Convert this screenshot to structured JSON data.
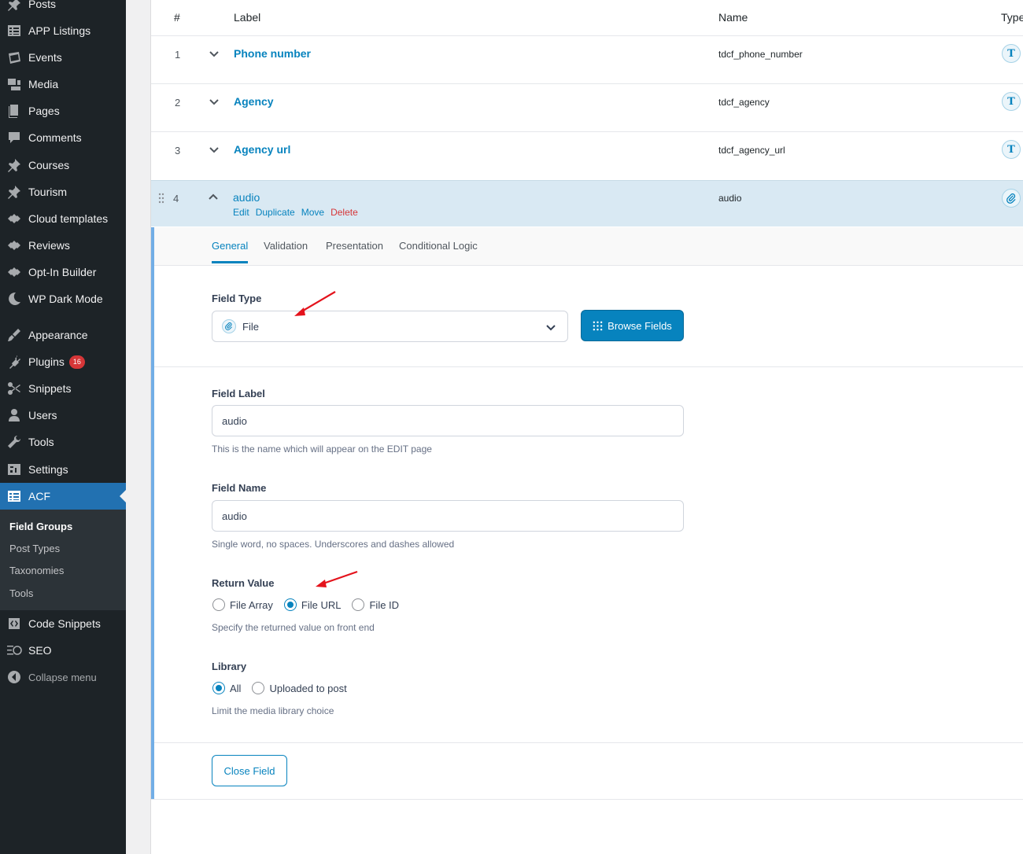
{
  "sidebar": {
    "items": [
      {
        "label": "Posts",
        "icon": "pin-icon"
      },
      {
        "label": "APP Listings",
        "icon": "table-icon"
      },
      {
        "label": "Events",
        "icon": "calendar-icon"
      },
      {
        "label": "Media",
        "icon": "media-icon"
      },
      {
        "label": "Pages",
        "icon": "page-icon"
      },
      {
        "label": "Comments",
        "icon": "comment-icon"
      },
      {
        "label": "Courses",
        "icon": "pin-icon"
      },
      {
        "label": "Tourism",
        "icon": "pin-icon"
      },
      {
        "label": "Cloud templates",
        "icon": "diamond-icon"
      },
      {
        "label": "Reviews",
        "icon": "diamond-icon"
      },
      {
        "label": "Opt-In Builder",
        "icon": "diamond-icon"
      },
      {
        "label": "WP Dark Mode",
        "icon": "moon-icon"
      },
      {
        "label": "Appearance",
        "icon": "brush-icon"
      },
      {
        "label": "Plugins",
        "icon": "plugin-icon",
        "badge": "16"
      },
      {
        "label": "Snippets",
        "icon": "scissors-icon"
      },
      {
        "label": "Users",
        "icon": "user-icon"
      },
      {
        "label": "Tools",
        "icon": "wrench-icon"
      },
      {
        "label": "Settings",
        "icon": "settings-icon"
      },
      {
        "label": "ACF",
        "icon": "table-icon"
      },
      {
        "label": "Code Snippets",
        "icon": "code-icon"
      },
      {
        "label": "SEO",
        "icon": "seo-icon"
      },
      {
        "label": "Collapse menu",
        "icon": "collapse-icon"
      }
    ],
    "submenu": [
      "Field Groups",
      "Post Types",
      "Taxonomies",
      "Tools"
    ]
  },
  "table": {
    "headers": {
      "num": "#",
      "label": "Label",
      "name": "Name",
      "type": "Type"
    },
    "rows": [
      {
        "num": "1",
        "label": "Phone number",
        "name": "tdcf_phone_number",
        "type_glyph": "T"
      },
      {
        "num": "2",
        "label": "Agency",
        "name": "tdcf_agency",
        "type_glyph": "T"
      },
      {
        "num": "3",
        "label": "Agency url",
        "name": "tdcf_agency_url",
        "type_glyph": "T"
      },
      {
        "num": "4",
        "label": "audio",
        "name": "audio",
        "type_glyph": "📎"
      }
    ],
    "row_actions": [
      "Edit",
      "Duplicate",
      "Move",
      "Delete"
    ]
  },
  "settings": {
    "tabs": [
      "General",
      "Validation",
      "Presentation",
      "Conditional Logic"
    ],
    "field_type": {
      "label": "Field Type",
      "value": "File",
      "browse_label": "Browse Fields"
    },
    "field_label": {
      "label": "Field Label",
      "value": "audio",
      "hint": "This is the name which will appear on the EDIT page"
    },
    "field_name": {
      "label": "Field Name",
      "value": "audio",
      "hint": "Single word, no spaces. Underscores and dashes allowed"
    },
    "return_value": {
      "label": "Return Value",
      "options": [
        "File Array",
        "File URL",
        "File ID"
      ],
      "selected": "File URL",
      "hint": "Specify the returned value on front end"
    },
    "library": {
      "label": "Library",
      "options": [
        "All",
        "Uploaded to post"
      ],
      "selected": "All",
      "hint": "Limit the media library choice"
    },
    "close_label": "Close Field"
  },
  "colors": {
    "accent": "#0783be",
    "sidebar_bg": "#1d2327",
    "active_menu": "#2271b1",
    "delete": "#d63638",
    "annotation_arrow": "#e4131c"
  }
}
